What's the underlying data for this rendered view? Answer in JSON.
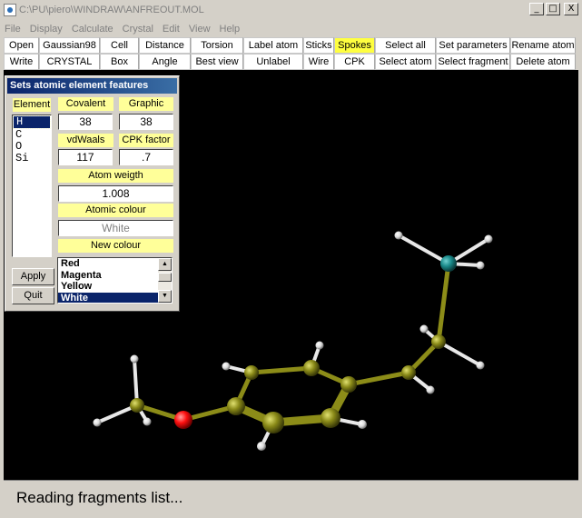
{
  "window": {
    "title": "C:\\PU\\piero\\WINDRAW\\ANFREOUT.MOL"
  },
  "window_buttons": {
    "minimize": "_",
    "maximize": "□",
    "close": "X"
  },
  "menubar": [
    "File",
    "Display",
    "Calculate",
    "Crystal",
    "Edit",
    "View",
    "Help"
  ],
  "toolbar": {
    "row1": [
      {
        "label": "Open",
        "highlight": false
      },
      {
        "label": "Gaussian98",
        "highlight": false
      },
      {
        "label": "Cell",
        "highlight": false
      },
      {
        "label": "Distance",
        "highlight": false
      },
      {
        "label": "Torsion",
        "highlight": false
      },
      {
        "label": "Label atom",
        "highlight": false
      },
      {
        "label": "Sticks",
        "highlight": false
      },
      {
        "label": "Spokes",
        "highlight": true
      },
      {
        "label": "Select all",
        "highlight": false
      },
      {
        "label": "Set  parameters",
        "highlight": false
      },
      {
        "label": "Rename atom",
        "highlight": false
      }
    ],
    "row2": [
      {
        "label": "Write",
        "highlight": false
      },
      {
        "label": "CRYSTAL",
        "highlight": false
      },
      {
        "label": "Box",
        "highlight": false
      },
      {
        "label": "Angle",
        "highlight": false
      },
      {
        "label": "Best view",
        "highlight": false
      },
      {
        "label": "Unlabel",
        "highlight": false
      },
      {
        "label": "Wire",
        "highlight": false
      },
      {
        "label": "CPK",
        "highlight": false
      },
      {
        "label": "Select atom",
        "highlight": false
      },
      {
        "label": "Select fragment",
        "highlight": false
      },
      {
        "label": "Delete atom",
        "highlight": false
      }
    ]
  },
  "panel": {
    "title": "Sets atomic element features",
    "element_label": "Element",
    "elements": [
      "H",
      "C",
      "O",
      "Si"
    ],
    "selected_element": "H",
    "covalent_label": "Covalent",
    "covalent_value": "38",
    "graphic_label": "Graphic",
    "graphic_value": "38",
    "vdwaals_label": "vdWaals",
    "vdwaals_value": "117",
    "cpk_label": "CPK factor",
    "cpk_value": ".7",
    "weight_label": "Atom weigth",
    "weight_value": "1.008",
    "colour_label": "Atomic colour",
    "colour_value": "White",
    "new_colour_label": "New  colour",
    "colour_options": [
      "Red",
      "Magenta",
      "Yellow",
      "White"
    ],
    "selected_colour": "White",
    "apply_label": "Apply",
    "quit_label": "Quit"
  },
  "molecule_colors": {
    "carbon": "#8a8a18",
    "hydrogen": "#ffffff",
    "oxygen": "#ff1010",
    "silicon": "#1a8a8a",
    "bond": "#8c8c18"
  },
  "status": {
    "text": "Reading fragments list..."
  }
}
